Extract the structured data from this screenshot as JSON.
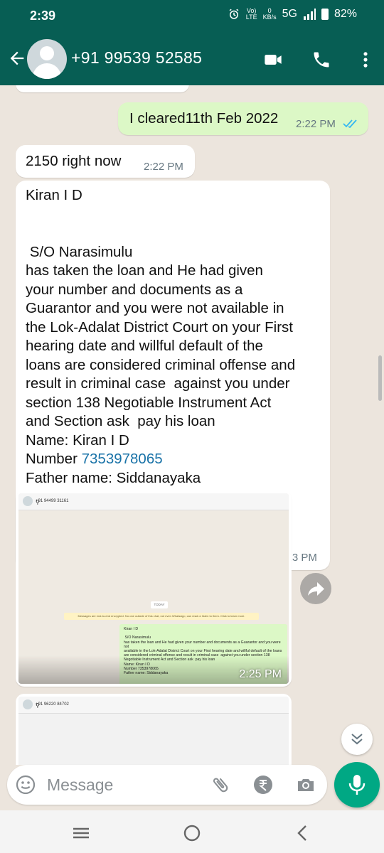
{
  "status_bar": {
    "time": "2:39",
    "network_top": "Vo)",
    "network_bottom": "LTE",
    "speed_top": "0",
    "speed_bottom": "KB/s",
    "network_type": "5G",
    "battery": "82%"
  },
  "header": {
    "contact": "+91 99539 52585",
    "icons": [
      "back-arrow-icon",
      "avatar",
      "video-call-icon",
      "phone-icon",
      "more-options-icon"
    ]
  },
  "messages": [
    {
      "type": "outgoing",
      "text": "I cleared11th Feb 2022",
      "time": "2:22 PM",
      "status": "read"
    },
    {
      "type": "incoming",
      "text": "2150 right now",
      "time": "2:22 PM"
    },
    {
      "type": "incoming",
      "line_name": "Kiran I D",
      "body": " S/O Narasimulu\nhas taken the loan and He had given\nyour number and documents as a\nGuarantor and you were not available in\nthe Lok-Adalat District Court on your First\nhearing date and willful default of the\nloans are considered criminal offense and\nresult in criminal case  against you under\nsection 138 Negotiable Instrument Act\nand Section ask  pay his loan\nName: Kiran I D",
      "number_label": "Number ",
      "number": "7353978065",
      "father": "Father name: Siddanayaka",
      "time": "2:23 PM"
    },
    {
      "type": "image",
      "time": "2:25 PM",
      "shot": {
        "contact": "+91 94499 31161",
        "today": "TODAY",
        "encryption": "Messages are end-to-end encrypted. No one outside of this chat, not even WhatsApp, can read or listen to them. Click to learn more.",
        "bubble_text": "Kiran I D\n\n S/O Narasimulu\nhas taken the loan and He had given your number and documents as a Guarantor and you were not\navailable in the Lok-Adalat District Court on your First hearing date and willful default of the loans\nare considered criminal offense and result in criminal case  against you under section 138\nNegotiable Instrument Act and Section ask  pay his loan\nName: Kiran I D\nNumber 7353978065\nFather name: Siddanayaka"
      }
    },
    {
      "type": "image",
      "shot": {
        "contact": "+91 96220 84702"
      }
    }
  ],
  "composer": {
    "placeholder": "Message"
  },
  "colors": {
    "header": "#075E54",
    "outgoing": "#DCF8C6",
    "accent": "#00A884",
    "link": "#1a73a8"
  }
}
